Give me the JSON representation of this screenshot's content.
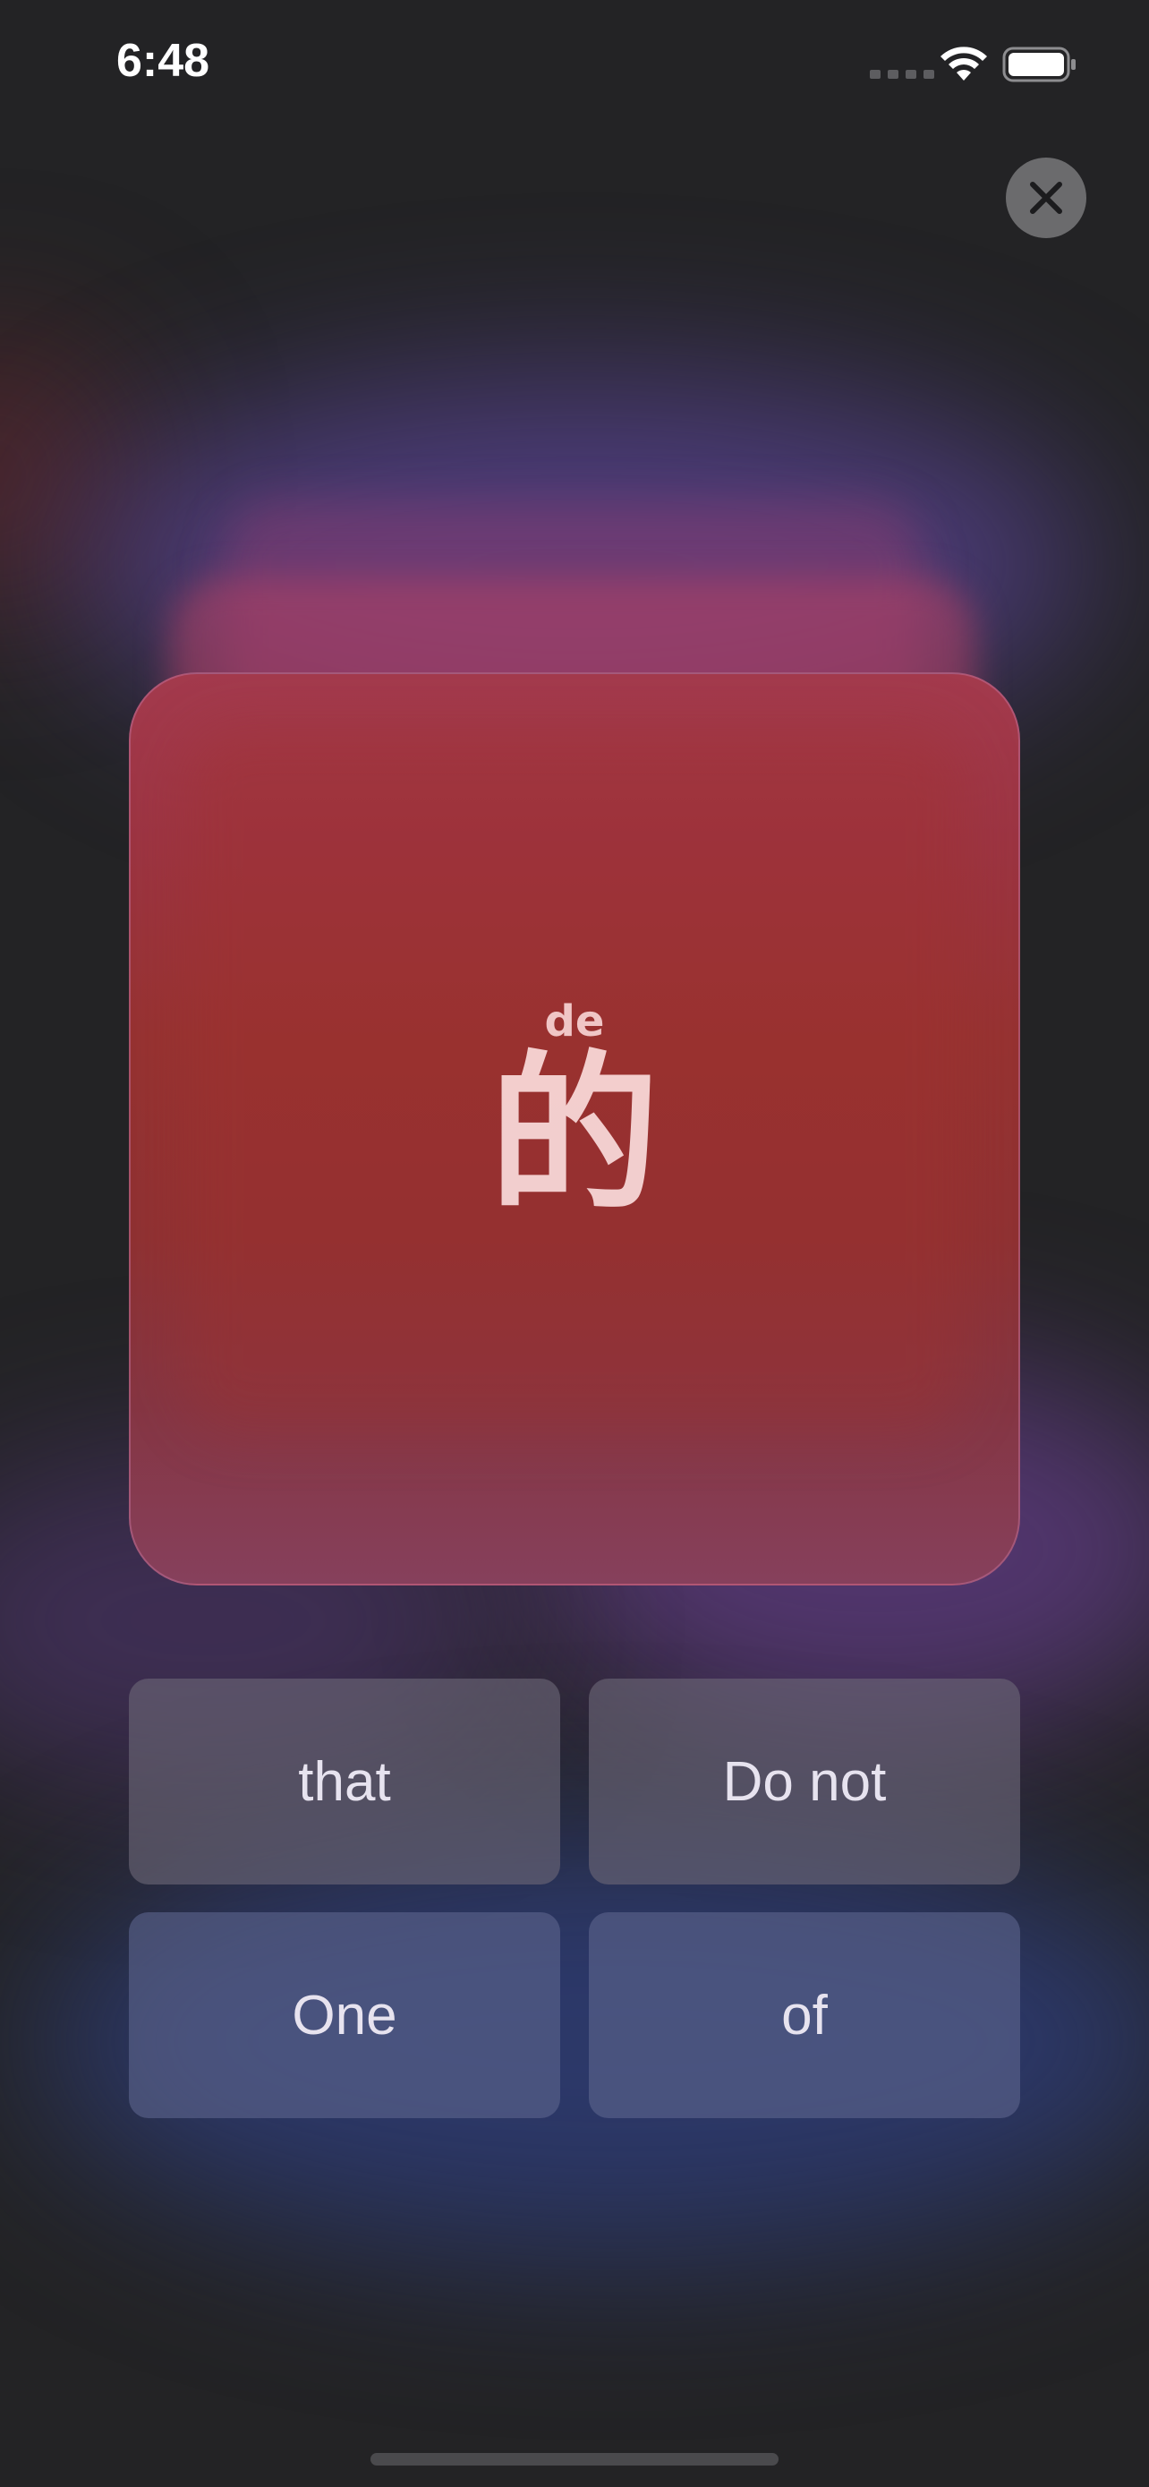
{
  "status_bar": {
    "time": "6:48",
    "icons": [
      "cellular-signal-icon",
      "wifi-icon",
      "battery-icon"
    ]
  },
  "close_button": {
    "icon": "close-icon"
  },
  "flashcard": {
    "pinyin": "de",
    "character": "的",
    "accent_color": "#963231"
  },
  "answers": [
    {
      "label": "that"
    },
    {
      "label": "Do not"
    },
    {
      "label": "One"
    },
    {
      "label": "of"
    }
  ],
  "colors": {
    "background": "#232325",
    "card_top": "#a33a4d",
    "card_bottom": "#86405c",
    "button_top": "#6c6878",
    "button_bottom": "#5c648c"
  }
}
